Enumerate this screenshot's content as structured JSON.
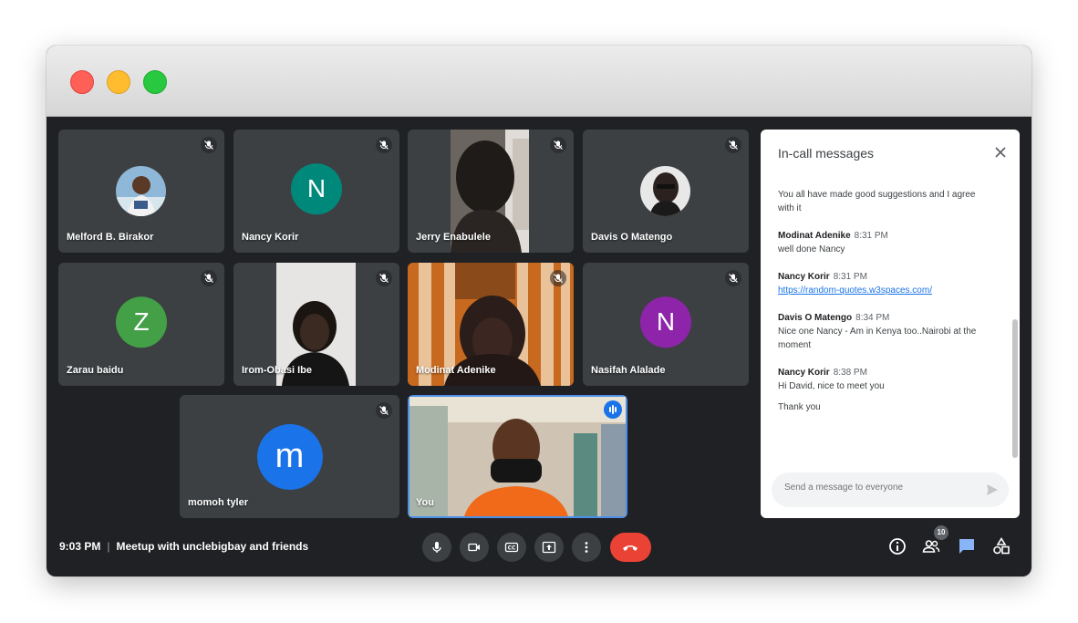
{
  "window": {
    "controls": [
      "close",
      "minimize",
      "maximize"
    ]
  },
  "participants": [
    {
      "name": "Melford B. Birakor",
      "muted": true,
      "kind": "photo"
    },
    {
      "name": "Nancy Korir",
      "muted": true,
      "avatar_letter": "N",
      "avatar_color": "#00897b"
    },
    {
      "name": "Jerry Enabulele",
      "muted": true,
      "kind": "video"
    },
    {
      "name": "Davis O Matengo",
      "muted": true,
      "kind": "photo"
    },
    {
      "name": "Zarau baidu",
      "muted": true,
      "avatar_letter": "Z",
      "avatar_color": "#43a047"
    },
    {
      "name": "Irom-Obasi Ibe",
      "muted": true,
      "kind": "video"
    },
    {
      "name": "Modinat Adenike",
      "muted": true,
      "kind": "video"
    },
    {
      "name": "Nasifah Alalade",
      "muted": true,
      "avatar_letter": "N",
      "avatar_color": "#8e24aa"
    },
    {
      "name": "momoh tyler",
      "muted": true,
      "avatar_letter": "m",
      "avatar_color": "#1a73e8"
    },
    {
      "name": "You",
      "speaking": true,
      "kind": "video"
    }
  ],
  "chat": {
    "title": "In-call messages",
    "messages": [
      {
        "text": "You all have made good suggestions and I agree with it"
      },
      {
        "sender": "Modinat Adenike",
        "time": "8:31 PM",
        "text": "well done Nancy"
      },
      {
        "sender": "Nancy Korir",
        "time": "8:31 PM",
        "link": "https://random-quotes.w3spaces.com/"
      },
      {
        "sender": "Davis O Matengo",
        "time": "8:34 PM",
        "text": "Nice one Nancy - Am in Kenya too..Nairobi at the moment"
      },
      {
        "sender": "Nancy Korir",
        "time": "8:38 PM",
        "text": "Hi David, nice to meet you",
        "text2": "Thank you"
      }
    ],
    "placeholder": "Send a message to everyone"
  },
  "bottom_bar": {
    "time": "9:03 PM",
    "separator": "|",
    "meeting_title": "Meetup with unclebigbay and friends",
    "controls": [
      "mic-icon",
      "camera-icon",
      "captions-icon",
      "present-icon",
      "more-icon",
      "hangup-icon"
    ],
    "people_count": "10",
    "right_icons": [
      "info-icon",
      "people-icon",
      "chat-icon",
      "activities-icon"
    ]
  },
  "colors": {
    "accent": "#1a73e8",
    "hangup": "#ea4335",
    "background": "#202124",
    "tile": "#3c4043"
  }
}
